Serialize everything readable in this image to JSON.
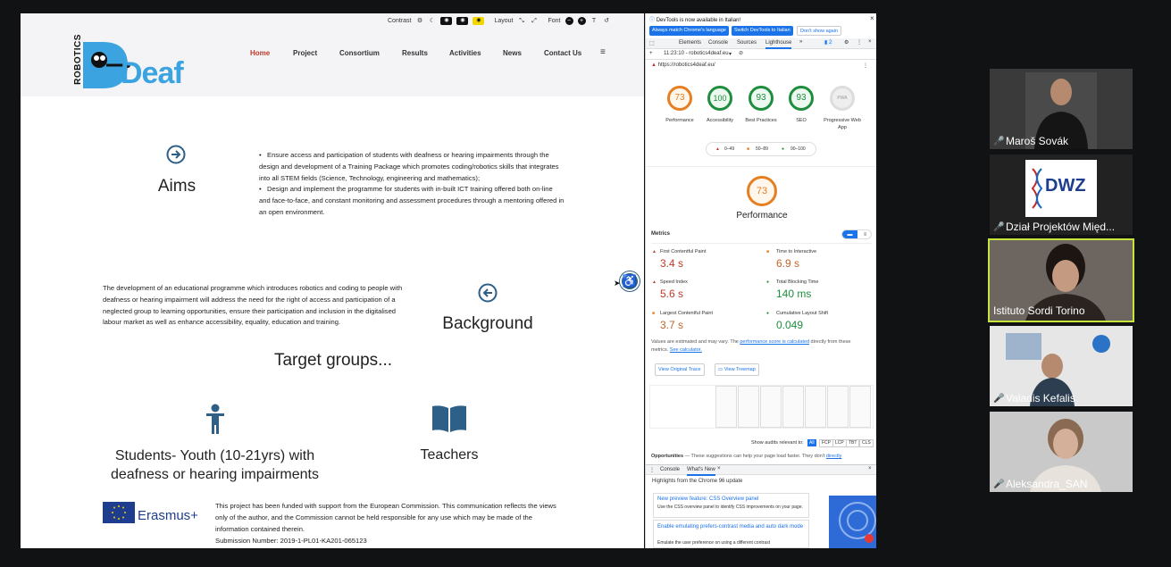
{
  "site": {
    "toolbar": {
      "contrast_label": "Contrast",
      "layout_label": "Layout",
      "font_label": "Font"
    },
    "logo": {
      "vertical": "ROBOTICS",
      "word": "Deaf"
    },
    "nav": [
      "Home",
      "Project",
      "Consortium",
      "Results",
      "Activities",
      "News",
      "Contact Us"
    ],
    "aims": {
      "heading": "Aims",
      "bullets": [
        "Ensure access and participation of students with deafness or hearing impairments through the design and development of a Training Package which promotes coding/robotics skills that integrates into all STEM fields (Science, Technology, engineering and mathematics);",
        "Design and implement the programme for students with in-built ICT training offered both on-line and face-to-face, and constant monitoring and assessment procedures through a mentoring offered in an open environment."
      ]
    },
    "background": {
      "heading": "Background",
      "text": "The development of an educational programme which introduces robotics and coding to people with deafness or hearing impairment will address the need for the right of access and participation of a neglected group to learning opportunities, ensure their participation and inclusion in the digitalised labour market as well as enhance accessibility, equality, education and training."
    },
    "target_groups": {
      "heading": "Target groups...",
      "students": "Students- Youth (10-21yrs) with deafness or hearing impairments",
      "teachers": "Teachers"
    },
    "footer": {
      "erasmus": "Erasmus+",
      "disclaimer": "This project has been funded with support from the European Commission. This communication reflects the views only of the author, and the Commission cannot be held responsible for any use which may be made of the information contained therein.",
      "submission": "Submission Number: 2019-1-PL01-KA201-065123"
    }
  },
  "devtools": {
    "notice": "DevTools is now available in Italian!",
    "btn_match": "Always match Chrome's language",
    "btn_switch": "Switch DevTools to Italian",
    "btn_dont": "Don't show again",
    "tabs": [
      "Elements",
      "Console",
      "Sources",
      "Lighthouse"
    ],
    "badge": "2",
    "report_selector": "11:23:10 - robotics4deaf.eu",
    "url": "https://robotics4deaf.eu/",
    "scores": [
      {
        "value": "73",
        "label": "Performance",
        "color": "#e67e22"
      },
      {
        "value": "100",
        "label": "Accessibility",
        "color": "#1e8e3e"
      },
      {
        "value": "93",
        "label": "Best Practices",
        "color": "#1e8e3e"
      },
      {
        "value": "93",
        "label": "SEO",
        "color": "#1e8e3e"
      },
      {
        "value": "PWA",
        "label": "Progressive Web App",
        "color": "#9e9e9e"
      }
    ],
    "legend": [
      "0–49",
      "50–89",
      "90–100"
    ],
    "perf_score": "73",
    "perf_label": "Performance",
    "metrics_title": "Metrics",
    "metrics": [
      {
        "name": "First Contentful Paint",
        "value": "3.4 s",
        "color": "#c0392b"
      },
      {
        "name": "Time to Interactive",
        "value": "6.9 s",
        "color": "#c0652b"
      },
      {
        "name": "Speed Index",
        "value": "5.6 s",
        "color": "#c0392b"
      },
      {
        "name": "Total Blocking Time",
        "value": "140 ms",
        "color": "#1e8e3e"
      },
      {
        "name": "Largest Contentful Paint",
        "value": "3.7 s",
        "color": "#c0652b"
      },
      {
        "name": "Cumulative Layout Shift",
        "value": "0.049",
        "color": "#1e8e3e"
      }
    ],
    "estimate_a": "Values are estimated and may vary. The ",
    "estimate_link": "performance score is calculated",
    "estimate_b": " directly from these metrics. ",
    "estimate_calc": "See calculator.",
    "btn_trace": "View Original Trace",
    "btn_treemap": "View Treemap",
    "audits_label": "Show audits relevant to:",
    "audit_chips": [
      "All",
      "FCP",
      "LCP",
      "TBT",
      "CLS"
    ],
    "opportunities": "Opportunities",
    "opportunities_text": " — These suggestions can help your page load faster. They don't ",
    "opportunities_link": "directly",
    "drawer_tabs": [
      "Console",
      "What's New"
    ],
    "highlights": "Highlights from the Chrome 96 update",
    "news": [
      {
        "title": "New preview feature: CSS Overview panel",
        "text": "Use the CSS overview panel to identify CSS improvements on your page."
      },
      {
        "title": "Enable emulating prefers-contrast media and auto dark mode",
        "text": "Emulate the user preference on using a different contrast"
      }
    ]
  },
  "participants": [
    {
      "name": "Maroš Sovák"
    },
    {
      "name": "Dział Projektów Międ..."
    },
    {
      "name": "Istituto Sordi Torino"
    },
    {
      "name": "Valadis Kefalis"
    },
    {
      "name": "Aleksandra_SAN"
    }
  ],
  "dwz_logo": "DWZ"
}
